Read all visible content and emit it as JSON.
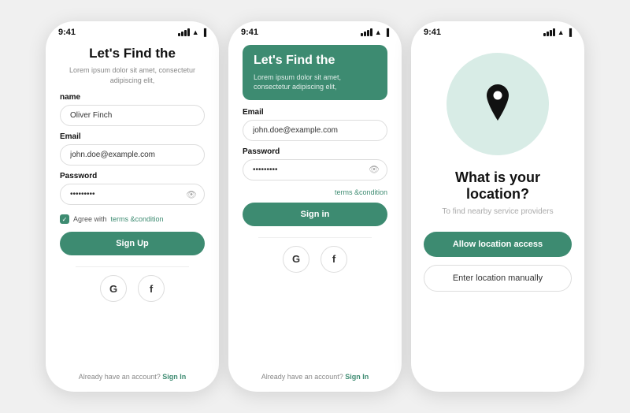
{
  "screens": [
    {
      "id": "signup",
      "statusBar": {
        "time": "9:41",
        "icons": "signal wifi battery"
      },
      "header": {
        "title": "Let's Find the",
        "subtitle": "Lorem ipsum dolor sit amet,\nconsectetur adipiscing elit,"
      },
      "fields": [
        {
          "label": "name",
          "placeholder": "Oliver Finch",
          "type": "text",
          "value": "Oliver Finch"
        },
        {
          "label": "Email",
          "placeholder": "john.doe@example.com",
          "type": "email",
          "value": "john.doe@example.com"
        },
        {
          "label": "Password",
          "placeholder": "••••••••",
          "type": "password",
          "value": "••••••••"
        }
      ],
      "agreeText": "Agree with",
      "agreeLink": "terms &condition",
      "primaryButton": "Sign Up",
      "socialButtons": [
        "G",
        "f"
      ],
      "footer": {
        "text": "Already have an account?",
        "link": "Sign In"
      }
    },
    {
      "id": "signin",
      "statusBar": {
        "time": "9:41"
      },
      "header": {
        "title": "Let's Find the",
        "subtitle": "Lorem ipsum dolor sit amet, consectetur adipiscing elit,"
      },
      "highlightHeader": {
        "title": "Let's Find the",
        "subtitle": "Lorem ipsum dolor sit amet, consectetur adipiscing elit,"
      },
      "fields": [
        {
          "label": "Email",
          "placeholder": "john.doe@example.com",
          "type": "email",
          "value": "john.doe@example.com"
        },
        {
          "label": "Password",
          "placeholder": "••••••••",
          "type": "password",
          "value": "••••••••"
        }
      ],
      "termsLink": "terms &condition",
      "primaryButton": "Sign in",
      "socialButtons": [
        "G",
        "f"
      ],
      "footer": {
        "text": "Already have an account?",
        "link": "Sign In"
      }
    },
    {
      "id": "location",
      "statusBar": {
        "time": "9:41"
      },
      "title": "What is your location?",
      "subtitle": "To find nearby service providers",
      "primaryButton": "Allow location access",
      "secondaryButton": "Enter location manually"
    }
  ]
}
